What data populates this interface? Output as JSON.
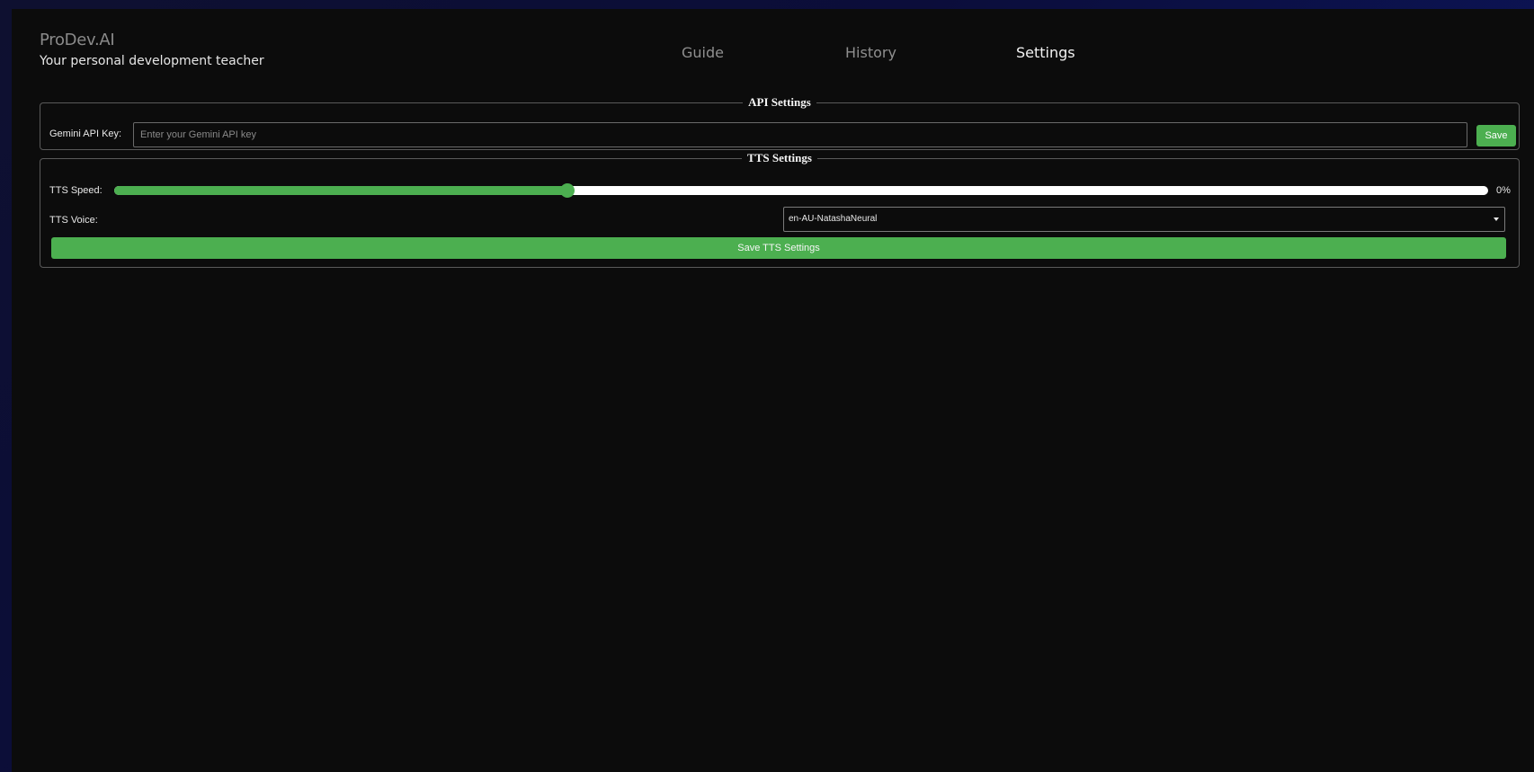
{
  "header": {
    "brand_title": "ProDev.AI",
    "brand_subtitle": "Your personal development teacher",
    "nav": [
      {
        "label": "Guide"
      },
      {
        "label": "History"
      },
      {
        "label": "Settings"
      }
    ],
    "active_tab": "Settings"
  },
  "api_settings": {
    "legend": "API Settings",
    "key_label": "Gemini API Key:",
    "key_value": "",
    "key_placeholder": "Enter your Gemini API key",
    "save_label": "Save"
  },
  "tts_settings": {
    "legend": "TTS Settings",
    "speed_label": "TTS Speed:",
    "speed_slider_fraction": 0.33,
    "speed_value_text": "0%",
    "voice_label": "TTS Voice:",
    "voice_selected": "en-AU-NatashaNeural",
    "save_label": "Save TTS Settings"
  },
  "colors": {
    "accent": "#4caf50",
    "background": "#0c0c0c",
    "border": "#5a5a5a"
  }
}
